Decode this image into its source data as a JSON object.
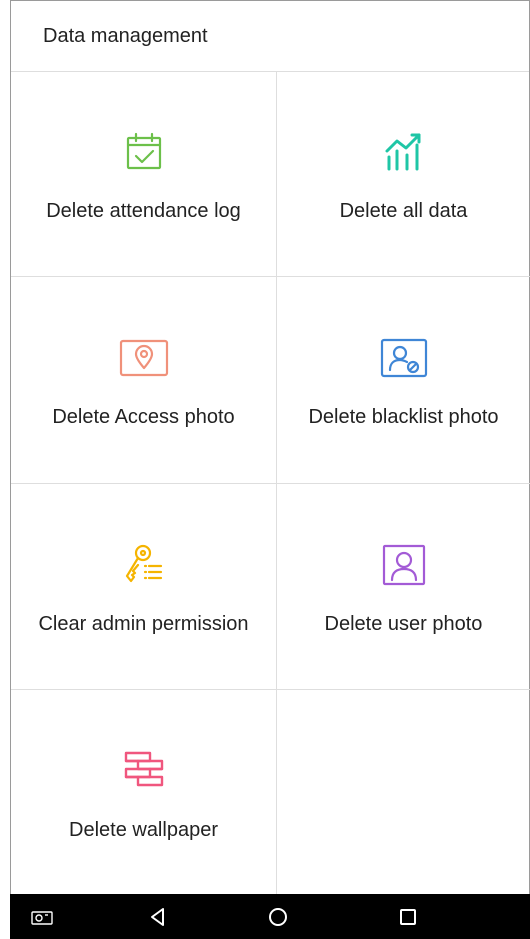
{
  "header": {
    "title": "Data management"
  },
  "tiles": [
    {
      "label": "Delete attendance log",
      "icon": "calendar-check-icon",
      "color": "#6cc04a"
    },
    {
      "label": "Delete all data",
      "icon": "growth-chart-icon",
      "color": "#1fc6a6"
    },
    {
      "label": "Delete Access photo",
      "icon": "location-photo-icon",
      "color": "#f0917a"
    },
    {
      "label": "Delete blacklist photo",
      "icon": "user-blocked-photo-icon",
      "color": "#3f86d6"
    },
    {
      "label": "Clear admin permission",
      "icon": "key-list-icon",
      "color": "#f5b400"
    },
    {
      "label": "Delete user photo",
      "icon": "user-photo-icon",
      "color": "#a35bd6"
    },
    {
      "label": "Delete wallpaper",
      "icon": "wallpaper-bricks-icon",
      "color": "#f0567e"
    }
  ],
  "navbar": {
    "buttons": [
      "camera-icon",
      "back-icon",
      "home-icon",
      "recents-icon"
    ]
  }
}
